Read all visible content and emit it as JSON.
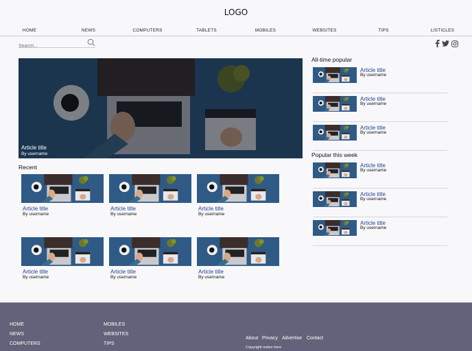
{
  "header": {
    "logo": "LOGO"
  },
  "nav": [
    "HOME",
    "NEWS",
    "COMPUTERS",
    "TABLETS",
    "MOBILES",
    "WEBSITES",
    "TIPS",
    "LISTICLES"
  ],
  "search": {
    "placeholder": "Search..."
  },
  "social": [
    "facebook-icon",
    "twitter-icon",
    "instagram-icon"
  ],
  "hero": {
    "title": "Article title",
    "author": "By username"
  },
  "recent": {
    "heading": "Recent",
    "items": [
      {
        "title": "Article title",
        "author": "By username"
      },
      {
        "title": "Article title",
        "author": "By username"
      },
      {
        "title": "Article title",
        "author": "By username"
      },
      {
        "title": "Article title",
        "author": "By username"
      },
      {
        "title": "Article title",
        "author": "By username"
      },
      {
        "title": "Article title",
        "author": "By username"
      }
    ]
  },
  "all_time": {
    "heading": "All-time popular",
    "items": [
      {
        "title": "Article title",
        "author": "By username"
      },
      {
        "title": "Article title",
        "author": "By username"
      },
      {
        "title": "Article title",
        "author": "By username"
      }
    ]
  },
  "this_week": {
    "heading": "Popular this week",
    "items": [
      {
        "title": "Article title",
        "author": "By username"
      },
      {
        "title": "Article title",
        "author": "By username"
      },
      {
        "title": "Article title",
        "author": "By username"
      }
    ]
  },
  "footer": {
    "col1": [
      "HOME",
      "NEWS",
      "COMPUTERS"
    ],
    "col2": [
      "MOBILES",
      "WEBSITES",
      "TIPS"
    ],
    "links": [
      "About",
      "Privacy",
      "Advertise",
      "Contact"
    ],
    "copyright": "Copyright notice here"
  },
  "colors": {
    "accent": "#1f3f8a",
    "footer": "#62627a",
    "photo_bg": "#2f5a85"
  }
}
